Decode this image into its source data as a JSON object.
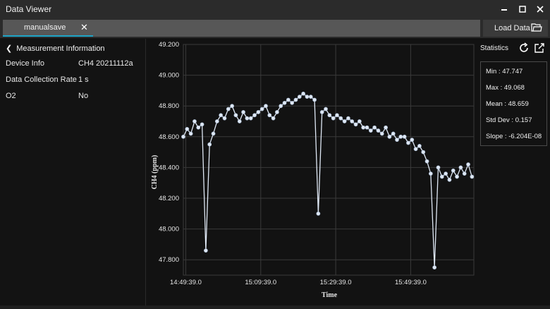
{
  "window": {
    "title": "Data Viewer"
  },
  "tabs": [
    {
      "label": "manualsave",
      "close": "✕"
    }
  ],
  "toolbar": {
    "load_label": "Load Data"
  },
  "measurement": {
    "header": "Measurement Information",
    "rows": [
      {
        "label": "Device Info",
        "value": "CH4 20211112a"
      },
      {
        "label": "Data Collection Rate",
        "value": "1 s"
      },
      {
        "label": "O2",
        "value": "No"
      }
    ]
  },
  "statistics": {
    "title": "Statistics",
    "items": [
      {
        "text": "Min : 47.747"
      },
      {
        "text": "Max : 49.068"
      },
      {
        "text": "Mean : 48.659"
      },
      {
        "text": "Std Dev : 0.157"
      },
      {
        "text": "Slope : -6.204E-08"
      }
    ]
  },
  "colors": {
    "accent": "#1ea5c8",
    "series": "#dfe8f5",
    "grid": "#3a3a3a"
  },
  "chart_data": {
    "type": "line",
    "xlabel": "Time",
    "ylabel": "CH4 (ppm)",
    "x_ticks": [
      "14:49:39.0",
      "15:09:39.0",
      "15:29:39.0",
      "15:49:39.0"
    ],
    "y_ticks": [
      "49.200",
      "49.000",
      "48.800",
      "48.600",
      "48.400",
      "48.200",
      "48.000",
      "47.800"
    ],
    "ylim": [
      47.7,
      49.2
    ],
    "xlim": [
      "14:49:00",
      "16:06:30"
    ],
    "grid": true,
    "series": [
      {
        "values": [
          [
            "14:49:00",
            48.6
          ],
          [
            "14:50:00",
            48.65
          ],
          [
            "14:51:00",
            48.62
          ],
          [
            "14:52:00",
            48.7
          ],
          [
            "14:53:00",
            48.66
          ],
          [
            "14:54:00",
            48.68
          ],
          [
            "14:55:00",
            47.86
          ],
          [
            "14:56:00",
            48.55
          ],
          [
            "14:57:00",
            48.62
          ],
          [
            "14:58:00",
            48.7
          ],
          [
            "14:59:00",
            48.74
          ],
          [
            "15:00:00",
            48.72
          ],
          [
            "15:01:00",
            48.78
          ],
          [
            "15:02:00",
            48.8
          ],
          [
            "15:03:00",
            48.74
          ],
          [
            "15:04:00",
            48.7
          ],
          [
            "15:05:00",
            48.76
          ],
          [
            "15:06:00",
            48.72
          ],
          [
            "15:07:00",
            48.72
          ],
          [
            "15:08:00",
            48.74
          ],
          [
            "15:09:00",
            48.76
          ],
          [
            "15:10:00",
            48.78
          ],
          [
            "15:11:00",
            48.8
          ],
          [
            "15:12:00",
            48.74
          ],
          [
            "15:13:00",
            48.72
          ],
          [
            "15:14:00",
            48.76
          ],
          [
            "15:15:00",
            48.8
          ],
          [
            "15:16:00",
            48.82
          ],
          [
            "15:17:00",
            48.84
          ],
          [
            "15:18:00",
            48.82
          ],
          [
            "15:19:00",
            48.84
          ],
          [
            "15:20:00",
            48.86
          ],
          [
            "15:21:00",
            48.88
          ],
          [
            "15:22:00",
            48.86
          ],
          [
            "15:23:00",
            48.86
          ],
          [
            "15:24:00",
            48.84
          ],
          [
            "15:25:00",
            48.1
          ],
          [
            "15:26:00",
            48.76
          ],
          [
            "15:27:00",
            48.78
          ],
          [
            "15:28:00",
            48.74
          ],
          [
            "15:29:00",
            48.72
          ],
          [
            "15:30:00",
            48.74
          ],
          [
            "15:31:00",
            48.72
          ],
          [
            "15:32:00",
            48.7
          ],
          [
            "15:33:00",
            48.72
          ],
          [
            "15:34:00",
            48.7
          ],
          [
            "15:35:00",
            48.68
          ],
          [
            "15:36:00",
            48.7
          ],
          [
            "15:37:00",
            48.66
          ],
          [
            "15:38:00",
            48.66
          ],
          [
            "15:39:00",
            48.64
          ],
          [
            "15:40:00",
            48.66
          ],
          [
            "15:41:00",
            48.64
          ],
          [
            "15:42:00",
            48.62
          ],
          [
            "15:43:00",
            48.66
          ],
          [
            "15:44:00",
            48.6
          ],
          [
            "15:45:00",
            48.62
          ],
          [
            "15:46:00",
            48.58
          ],
          [
            "15:47:00",
            48.6
          ],
          [
            "15:48:00",
            48.6
          ],
          [
            "15:49:00",
            48.56
          ],
          [
            "15:50:00",
            48.58
          ],
          [
            "15:51:00",
            48.52
          ],
          [
            "15:52:00",
            48.54
          ],
          [
            "15:53:00",
            48.5
          ],
          [
            "15:54:00",
            48.44
          ],
          [
            "15:55:00",
            48.36
          ],
          [
            "15:56:00",
            47.75
          ],
          [
            "15:57:00",
            48.4
          ],
          [
            "15:58:00",
            48.34
          ],
          [
            "15:59:00",
            48.36
          ],
          [
            "16:00:00",
            48.32
          ],
          [
            "16:01:00",
            48.38
          ],
          [
            "16:02:00",
            48.34
          ],
          [
            "16:03:00",
            48.4
          ],
          [
            "16:04:00",
            48.36
          ],
          [
            "16:05:00",
            48.42
          ],
          [
            "16:06:00",
            48.34
          ]
        ]
      }
    ]
  }
}
